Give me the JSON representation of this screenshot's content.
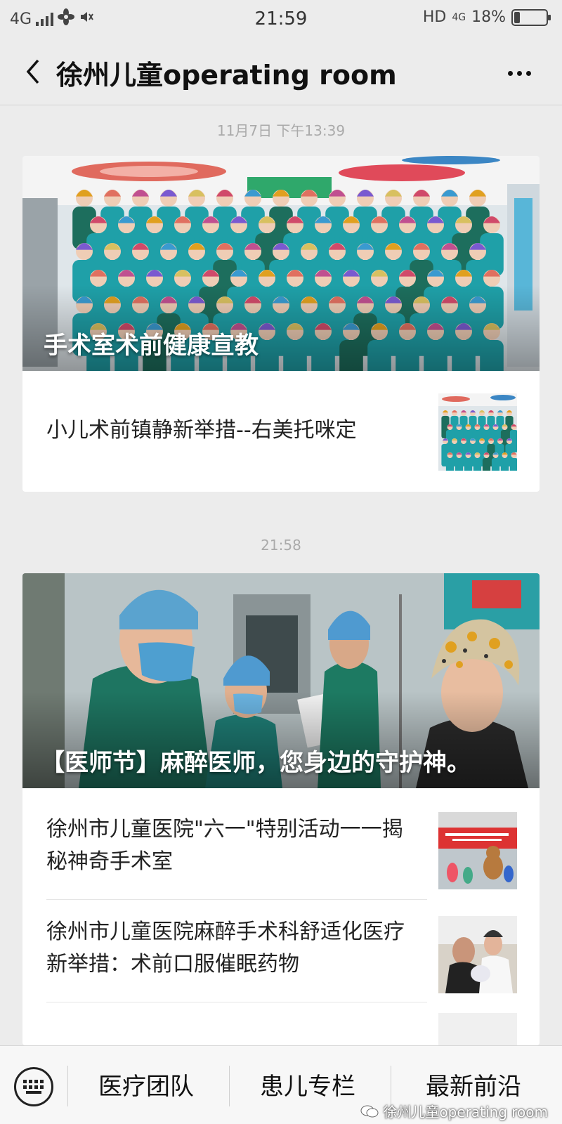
{
  "status_bar": {
    "network": "4G",
    "time": "21:59",
    "hd": "HD",
    "net2": "4G",
    "battery": "18%"
  },
  "header": {
    "title": "徐州儿童operating room"
  },
  "feed": {
    "stamp1": "11月7日 下午13:39",
    "card1": {
      "hero_title": "手术室术前健康宣教",
      "items": [
        {
          "text": "小儿术前镇静新举措--右美托咪定"
        }
      ]
    },
    "stamp2": "21:58",
    "card2": {
      "hero_title": "【医师节】麻醉医师，您身边的守护神。",
      "items": [
        {
          "text": "徐州市儿童医院\"六一\"特别活动一一揭秘神奇手术室"
        },
        {
          "text": "徐州市儿童医院麻醉手术科舒适化医疗新举措：术前口服催眠药物"
        }
      ]
    }
  },
  "menu": {
    "items": [
      "医疗团队",
      "患儿专栏",
      "最新前沿"
    ]
  },
  "watermark": "徐州儿童operating room",
  "colors": {
    "background": "#ececec",
    "scrub_teal": "#1fa0a8",
    "scrub_green": "#1d6e5d"
  },
  "icons": [
    "signal-icon",
    "fan-icon",
    "mute-icon",
    "battery-icon",
    "back-icon",
    "more-icon",
    "keyboard-icon",
    "wechat-icon"
  ]
}
